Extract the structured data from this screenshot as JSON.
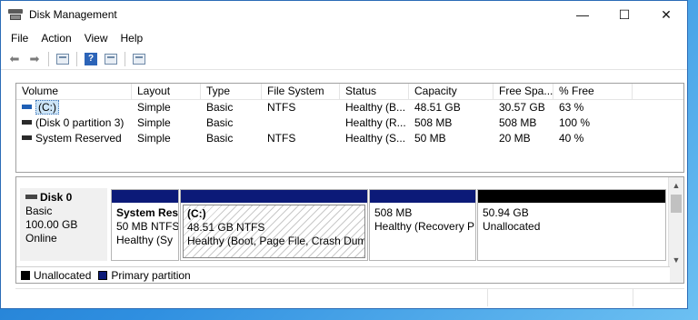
{
  "window": {
    "title": "Disk Management",
    "minimize": "—",
    "maximize": "☐",
    "close": "✕"
  },
  "menu": [
    "File",
    "Action",
    "View",
    "Help"
  ],
  "toolbar": {
    "icons": [
      "back-icon",
      "forward-icon",
      "properties-icon",
      "help-icon",
      "volume-list-icon",
      "disk-list-icon"
    ],
    "help_glyph": "?"
  },
  "volume_table": {
    "headers": [
      "Volume",
      "Layout",
      "Type",
      "File System",
      "Status",
      "Capacity",
      "Free Spa...",
      "% Free"
    ],
    "rows": [
      {
        "volume": "(C:)",
        "layout": "Simple",
        "type": "Basic",
        "fs": "NTFS",
        "status": "Healthy (B...",
        "capacity": "48.51 GB",
        "free": "30.57 GB",
        "pct": "63 %"
      },
      {
        "volume": "(Disk 0 partition 3)",
        "layout": "Simple",
        "type": "Basic",
        "fs": "",
        "status": "Healthy (R...",
        "capacity": "508 MB",
        "free": "508 MB",
        "pct": "100 %"
      },
      {
        "volume": "System Reserved",
        "layout": "Simple",
        "type": "Basic",
        "fs": "NTFS",
        "status": "Healthy (S...",
        "capacity": "50 MB",
        "free": "20 MB",
        "pct": "40 %"
      }
    ]
  },
  "disk": {
    "name": "Disk 0",
    "type": "Basic",
    "size": "100.00 GB",
    "state": "Online",
    "partitions": [
      {
        "name": "System Res",
        "size": "50 MB NTFS",
        "status": "Healthy (Sy"
      },
      {
        "name": "(C:)",
        "size": "48.51 GB NTFS",
        "status": "Healthy (Boot, Page File, Crash Dump"
      },
      {
        "name": "",
        "size": "508 MB",
        "status": "Healthy (Recovery P"
      },
      {
        "name": "",
        "size": "50.94 GB",
        "status": "Unallocated"
      }
    ]
  },
  "legend": {
    "unallocated": "Unallocated",
    "primary": "Primary partition"
  },
  "colors": {
    "primary_partition": "#0c1a78",
    "unallocated": "#000000",
    "selection": "#cce4f7"
  }
}
